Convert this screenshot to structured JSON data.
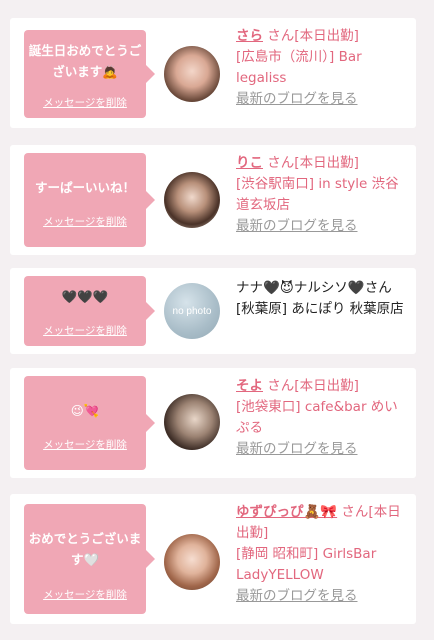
{
  "cards": [
    {
      "message": "誕生日おめでとうございます🙇",
      "delete_label": "メッセージを削除",
      "name": "さら",
      "honorific": "さん[本日出勤]",
      "shop": "[広島市（流川）] Bar legaliss",
      "blog_link": "最新のブログを見る"
    },
    {
      "message": "すーぱーいいね！",
      "delete_label": "メッセージを削除",
      "name": "りこ",
      "honorific": "さん[本日出勤]",
      "shop": "[渋谷駅南口] in style 渋谷道玄坂店",
      "blog_link": "最新のブログを見る"
    },
    {
      "message": "🖤🖤🖤",
      "delete_label": "メッセージを削除",
      "name_line": "ナナ🖤😈ナルシソ🖤さん",
      "shop": "[秋葉原] あにぽり 秋葉原店",
      "avatar_text": "no photo"
    },
    {
      "message": "😉💘",
      "delete_label": "メッセージを削除",
      "name": "そよ",
      "honorific": "さん[本日出勤]",
      "shop": "[池袋東口] cafe&bar めいぷる",
      "blog_link": "最新のブログを見る"
    },
    {
      "message": "おめでとうございます🤍",
      "delete_label": "メッセージを削除",
      "name": "ゆずぴっぴ🧸🎀",
      "honorific": "さん[本日出勤]",
      "shop": "[静岡 昭和町] GirlsBar LadyYELLOW",
      "blog_link": "最新のブログを見る"
    }
  ],
  "colors": {
    "bubble": "#f0a7b5",
    "accent": "#e2677e",
    "link_gray": "#999999",
    "background": "#f4f0f2"
  }
}
